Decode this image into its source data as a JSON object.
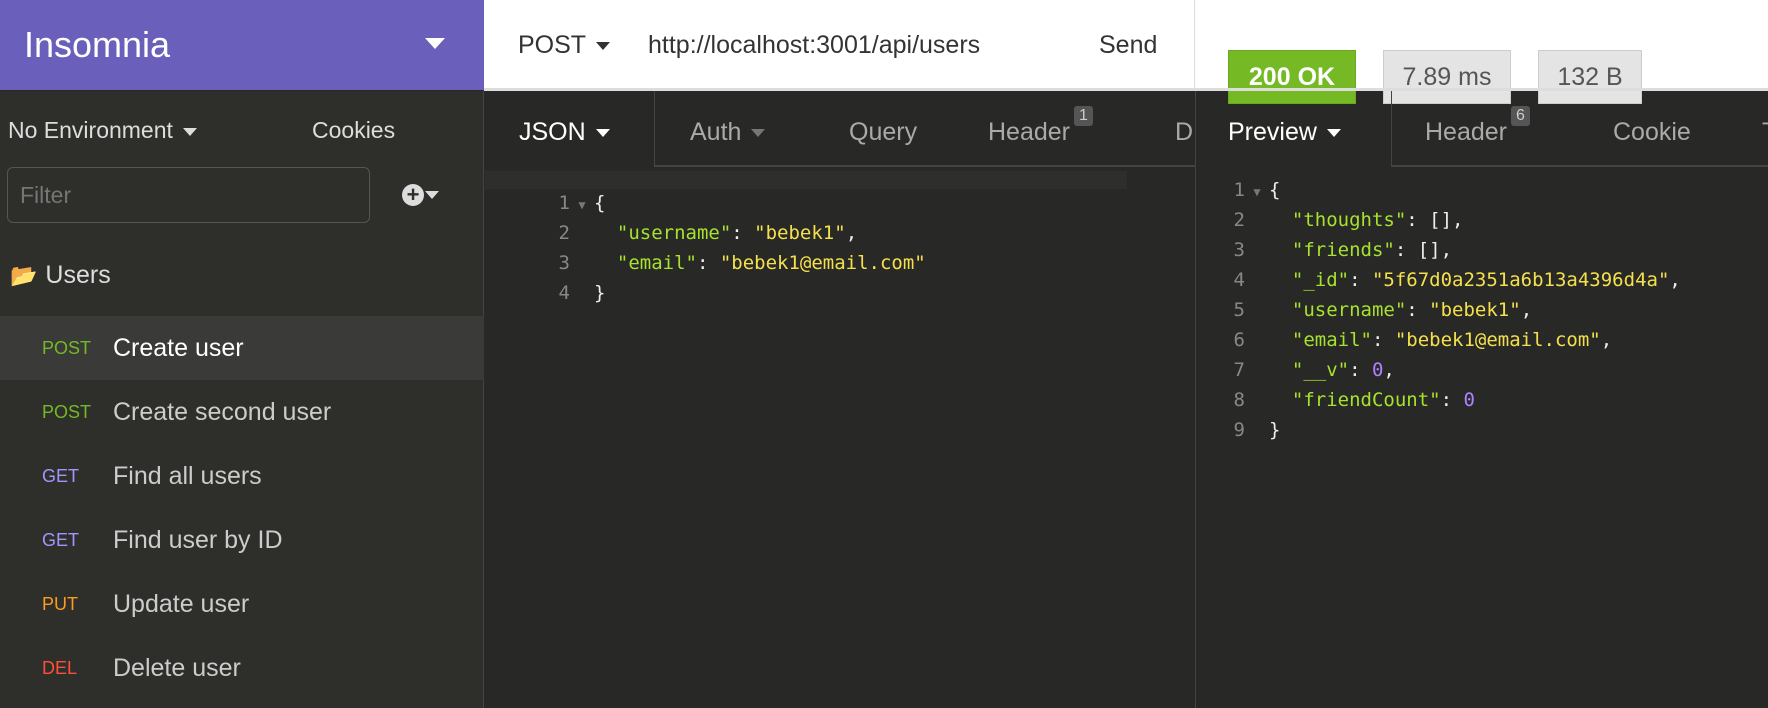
{
  "app": {
    "title": "Insomnia"
  },
  "request": {
    "method": "POST",
    "url": "http://localhost:3001/api/users",
    "send_label": "Send"
  },
  "response": {
    "status": "200 OK",
    "time": "7.89 ms",
    "size": "132 B",
    "status_color": "#75ba24"
  },
  "sidebar": {
    "environment": "No Environment",
    "cookies": "Cookies",
    "filter_placeholder": "Filter",
    "folder": "Users",
    "items": [
      {
        "method": "POST",
        "label": "Create user",
        "color": "#75ba24"
      },
      {
        "method": "POST",
        "label": "Create second user",
        "color": "#75ba24"
      },
      {
        "method": "GET",
        "label": "Find all users",
        "color": "#a196ff"
      },
      {
        "method": "GET",
        "label": "Find user by ID",
        "color": "#a196ff"
      },
      {
        "method": "PUT",
        "label": "Update user",
        "color": "#ff9a1f"
      },
      {
        "method": "DEL",
        "label": "Delete user",
        "color": "#ff4f3a"
      }
    ]
  },
  "request_tabs": [
    {
      "label": "JSON"
    },
    {
      "label": "Auth"
    },
    {
      "label": "Query"
    },
    {
      "label": "Header",
      "count": "1"
    },
    {
      "label": "D"
    }
  ],
  "response_tabs": [
    {
      "label": "Preview"
    },
    {
      "label": "Header",
      "count": "6"
    },
    {
      "label": "Cookie"
    },
    {
      "label": "T"
    }
  ],
  "request_body": [
    [
      [
        "p",
        "{"
      ]
    ],
    [
      [
        "k",
        "  \"username\""
      ],
      [
        "p",
        ": "
      ],
      [
        "s",
        "\"bebek1\""
      ],
      [
        "p",
        ","
      ]
    ],
    [
      [
        "k",
        "  \"email\""
      ],
      [
        "p",
        ": "
      ],
      [
        "s",
        "\"bebek1@email.com\""
      ]
    ],
    [
      [
        "p",
        "}"
      ]
    ]
  ],
  "response_body": [
    [
      [
        "p",
        "{"
      ]
    ],
    [
      [
        "k",
        "  \"thoughts\""
      ],
      [
        "p",
        ": [],"
      ]
    ],
    [
      [
        "k",
        "  \"friends\""
      ],
      [
        "p",
        ": [],"
      ]
    ],
    [
      [
        "k",
        "  \"_id\""
      ],
      [
        "p",
        ": "
      ],
      [
        "s",
        "\"5f67d0a2351a6b13a4396d4a\""
      ],
      [
        "p",
        ","
      ]
    ],
    [
      [
        "k",
        "  \"username\""
      ],
      [
        "p",
        ": "
      ],
      [
        "s",
        "\"bebek1\""
      ],
      [
        "p",
        ","
      ]
    ],
    [
      [
        "k",
        "  \"email\""
      ],
      [
        "p",
        ": "
      ],
      [
        "s",
        "\"bebek1@email.com\""
      ],
      [
        "p",
        ","
      ]
    ],
    [
      [
        "k",
        "  \"__v\""
      ],
      [
        "p",
        ": "
      ],
      [
        "n",
        "0"
      ],
      [
        "p",
        ","
      ]
    ],
    [
      [
        "k",
        "  \"friendCount\""
      ],
      [
        "p",
        ": "
      ],
      [
        "n",
        "0"
      ]
    ],
    [
      [
        "p",
        "}"
      ]
    ]
  ]
}
